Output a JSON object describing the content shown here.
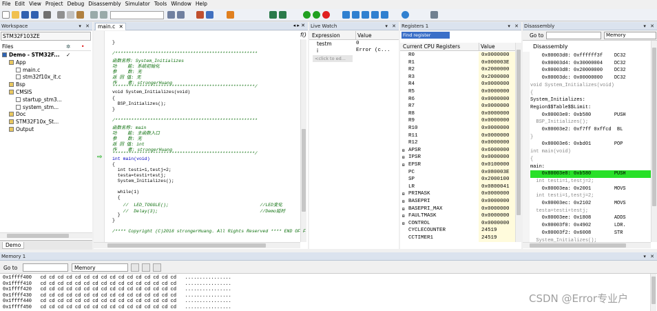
{
  "menu": [
    "File",
    "Edit",
    "View",
    "Project",
    "Debug",
    "Disassembly",
    "Simulator",
    "Tools",
    "Window",
    "Help"
  ],
  "workspace": {
    "title": "Workspace",
    "target": "STM32F103ZE",
    "files_label": "Files",
    "tree": [
      {
        "label": "Demo - STM32F...",
        "level": 0
      },
      {
        "label": "App",
        "level": 1
      },
      {
        "label": "main.c",
        "level": 2
      },
      {
        "label": "stm32f10x_it.c",
        "level": 2
      },
      {
        "label": "Bsp",
        "level": 1
      },
      {
        "label": "CMSIS",
        "level": 1
      },
      {
        "label": "startup_stm3...",
        "level": 2
      },
      {
        "label": "system_stm...",
        "level": 2
      },
      {
        "label": "Doc",
        "level": 1
      },
      {
        "label": "STM32F10x_St...",
        "level": 1
      },
      {
        "label": "Output",
        "level": 1
      }
    ],
    "bottom_tab": "Demo"
  },
  "editor": {
    "tab": "main.c",
    "func_label": "f()",
    "lines": [
      {
        "text": "}",
        "cls": ""
      },
      {
        "text": "",
        "cls": ""
      },
      {
        "text": "/*****************************************************",
        "cls": "comment"
      },
      {
        "text": "函数名称: System_Initializes",
        "cls": "comment"
      },
      {
        "text": "功    能: 系统初始化",
        "cls": "comment"
      },
      {
        "text": "参    数: 无",
        "cls": "comment"
      },
      {
        "text": "返 回 值: 无",
        "cls": "comment"
      },
      {
        "text": "作    者: strongerHuang",
        "cls": "comment"
      },
      {
        "text": "*****************************************************/",
        "cls": "comment"
      },
      {
        "text": "void System_Initializes(void)",
        "cls": ""
      },
      {
        "text": "{",
        "cls": ""
      },
      {
        "text": "  BSP_Initializes();",
        "cls": ""
      },
      {
        "text": "}",
        "cls": ""
      },
      {
        "text": "",
        "cls": ""
      },
      {
        "text": "/*****************************************************",
        "cls": "comment"
      },
      {
        "text": "函数名称: main",
        "cls": "comment"
      },
      {
        "text": "功    能: 主函数入口",
        "cls": "comment"
      },
      {
        "text": "参    数: 无",
        "cls": "comment"
      },
      {
        "text": "返 回 值: int",
        "cls": "comment"
      },
      {
        "text": "作    者: strongerHuang",
        "cls": "comment"
      },
      {
        "text": "*****************************************************/",
        "cls": "comment"
      },
      {
        "text": "int main(void)",
        "cls": "keyword"
      },
      {
        "text": "{",
        "cls": ""
      },
      {
        "text": "  int testi=1,testj=2;",
        "cls": ""
      },
      {
        "text": "  testa=testi+testj;",
        "cls": ""
      },
      {
        "text": "  System_Initializes();",
        "cls": ""
      },
      {
        "text": "",
        "cls": ""
      },
      {
        "text": "  while(1)",
        "cls": ""
      },
      {
        "text": "  {",
        "cls": ""
      },
      {
        "text": "    //  LED_TOGGLE();                                  //LED变化",
        "cls": "comment"
      },
      {
        "text": "    //  Delay(3);                                      //Demo延时",
        "cls": "comment"
      },
      {
        "text": "  }",
        "cls": ""
      },
      {
        "text": "}",
        "cls": ""
      },
      {
        "text": "",
        "cls": ""
      },
      {
        "text": "/**** Copyright (C)2018 strongerHuang. All Rights Reserved **** END OF F",
        "cls": "comment"
      }
    ]
  },
  "watch": {
    "title": "Live Watch",
    "col_expression": "Expression",
    "col_value": "Value",
    "rows": [
      {
        "expr": "testm",
        "value": "0"
      },
      {
        "expr": "i",
        "value": "Error (c..."
      }
    ],
    "add_placeholder": "<click to ed..."
  },
  "registers": {
    "title": "Registers 1",
    "find_placeholder": "Find register",
    "col_name": "Current CPU Registers",
    "col_value": "Value",
    "rows": [
      {
        "name": "R0",
        "value": "0x0000000",
        "expand": false
      },
      {
        "name": "R1",
        "value": "0x000003E",
        "expand": false
      },
      {
        "name": "R2",
        "value": "0x2000000",
        "expand": false
      },
      {
        "name": "R3",
        "value": "0x2000000",
        "expand": false
      },
      {
        "name": "R4",
        "value": "0x0000000",
        "expand": false
      },
      {
        "name": "R5",
        "value": "0x0000000",
        "expand": false
      },
      {
        "name": "R6",
        "value": "0x0000000",
        "expand": false
      },
      {
        "name": "R7",
        "value": "0x0000000",
        "expand": false
      },
      {
        "name": "R8",
        "value": "0x0000000",
        "expand": false
      },
      {
        "name": "R9",
        "value": "0x0000000",
        "expand": false
      },
      {
        "name": "R10",
        "value": "0x0000000",
        "expand": false
      },
      {
        "name": "R11",
        "value": "0x0000000",
        "expand": false
      },
      {
        "name": "R12",
        "value": "0x0000000",
        "expand": false
      },
      {
        "name": "APSR",
        "value": "0x6000000",
        "expand": true
      },
      {
        "name": "IPSR",
        "value": "0x0000000",
        "expand": true
      },
      {
        "name": "EPSR",
        "value": "0x0100000",
        "expand": true
      },
      {
        "name": "PC",
        "value": "0x080003E",
        "expand": false
      },
      {
        "name": "SP",
        "value": "0x2000100",
        "expand": false
      },
      {
        "name": "LR",
        "value": "0x0800041",
        "expand": false
      },
      {
        "name": "PRIMASK",
        "value": "0x0000000",
        "expand": true
      },
      {
        "name": "BASEPRI",
        "value": "0x0000000",
        "expand": true
      },
      {
        "name": "BASEPRI_MAX",
        "value": "0x0000000",
        "expand": true
      },
      {
        "name": "FAULTMASK",
        "value": "0x0000000",
        "expand": true
      },
      {
        "name": "CONTROL",
        "value": "0x0000000",
        "expand": true
      },
      {
        "name": "CYCLECOUNTER",
        "value": "24519",
        "expand": false
      },
      {
        "name": "CCTIMER1",
        "value": "24519",
        "expand": false
      }
    ]
  },
  "disassembly": {
    "title": "Disassembly",
    "goto_label": "Go to",
    "mode": "Memory",
    "header": "Disassembly",
    "lines": [
      {
        "text": "    0x80003d0: 0xffffff3f    DC32",
        "cls": ""
      },
      {
        "text": "    0x80003d4: 0x30000004    DC32",
        "cls": ""
      },
      {
        "text": "    0x80003d8: 0x20000000    DC32",
        "cls": ""
      },
      {
        "text": "    0x80003dc: 0x00000000    DC32",
        "cls": ""
      },
      {
        "text": "void System_Initializes(void)",
        "cls": "src"
      },
      {
        "text": "{",
        "cls": "src"
      },
      {
        "text": "System_Initializes:",
        "cls": ""
      },
      {
        "text": "Region$$Table$$Limit:",
        "cls": ""
      },
      {
        "text": "    0x80003e0: 0xb580        PUSH",
        "cls": ""
      },
      {
        "text": "  BSP_Initializes();",
        "cls": "src"
      },
      {
        "text": "    0x80003e2: 0xf7ff 0xffcd  BL",
        "cls": ""
      },
      {
        "text": "}",
        "cls": "src"
      },
      {
        "text": "    0x80003e6: 0xbd01        POP",
        "cls": ""
      },
      {
        "text": "int main(void)",
        "cls": "src"
      },
      {
        "text": "{",
        "cls": "src"
      },
      {
        "text": "main:",
        "cls": ""
      },
      {
        "text": "    0x80003e8: 0xb580        PUSH",
        "cls": "hl"
      },
      {
        "text": "  int testi=1,testj=2;",
        "cls": "src"
      },
      {
        "text": "    0x80003ea: 0x2001        MOVS",
        "cls": ""
      },
      {
        "text": "  int testi=1,testj=2;",
        "cls": "src"
      },
      {
        "text": "    0x80003ec: 0x2102        MOVS",
        "cls": ""
      },
      {
        "text": "  testa=testi+testj;",
        "cls": "src"
      },
      {
        "text": "    0x80003ee: 0x1808        ADDS",
        "cls": ""
      },
      {
        "text": "    0x80003f0: 0x4902        LDR.",
        "cls": ""
      },
      {
        "text": "    0x80003f2: 0x6008        STR",
        "cls": ""
      },
      {
        "text": "  System_Initializes();",
        "cls": "src"
      }
    ]
  },
  "memory": {
    "title": "Memory 1",
    "goto_label": "Go to",
    "mode": "Memory",
    "rows": [
      "0x1ffff400   cd cd cd cd cd cd cd cd cd cd cd cd cd cd cd cd   ................",
      "0x1ffff410   cd cd cd cd cd cd cd cd cd cd cd cd cd cd cd cd   ................",
      "0x1ffff420   cd cd cd cd cd cd cd cd cd cd cd cd cd cd cd cd   ................",
      "0x1ffff430   cd cd cd cd cd cd cd cd cd cd cd cd cd cd cd cd   ................",
      "0x1ffff440   cd cd cd cd cd cd cd cd cd cd cd cd cd cd cd cd   ................",
      "0x1ffff450   cd cd cd cd cd cd cd cd cd cd cd cd cd cd cd cd   ................"
    ]
  },
  "watermark": "CSDN @Error专业户",
  "colors": {
    "panel_header": "#dbe3ee",
    "highlight": "#28e028",
    "register_value_bg": "#fffbdc",
    "comment": "#0a6e0a",
    "keyword": "#0000c0"
  }
}
